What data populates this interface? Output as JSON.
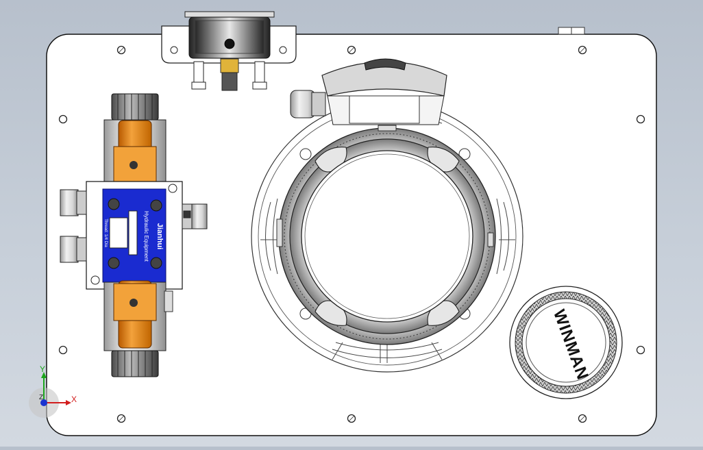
{
  "cad_view": {
    "brand_cap": {
      "text": "WINMAN"
    },
    "valve_label": {
      "brand": "Jianhui",
      "subtitle": "Hydraulic Equipment",
      "model": "Thread: 1/4 Dia"
    },
    "triad": {
      "x_label": "X",
      "y_label": "Y",
      "z_label": "Z"
    }
  }
}
